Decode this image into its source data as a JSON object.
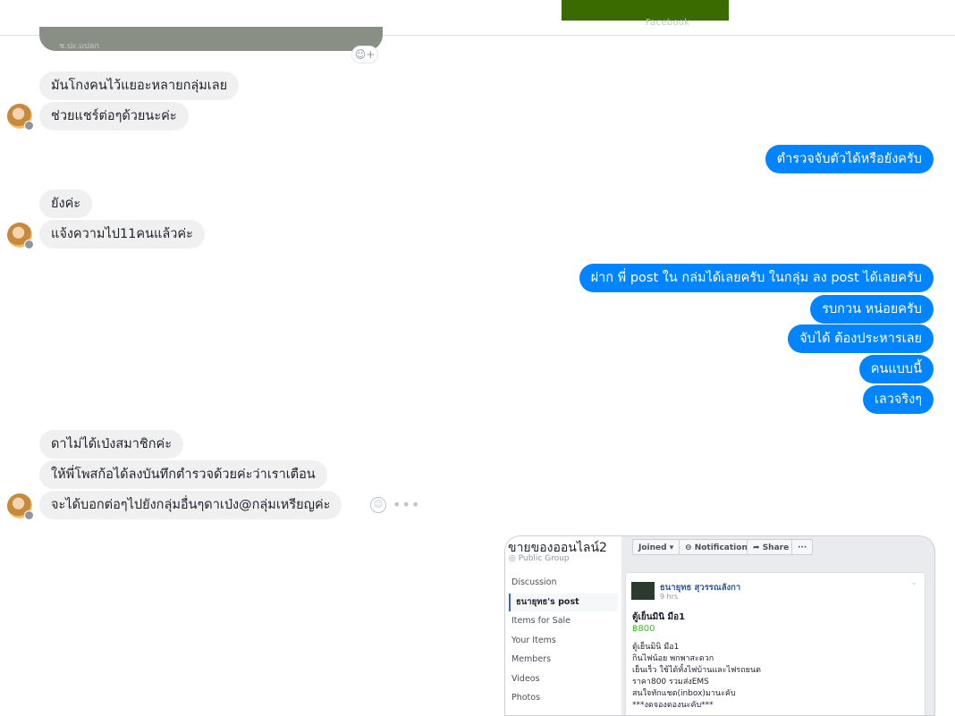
{
  "top": {
    "caption": "Facebook"
  },
  "prev_photo": {
    "text": "ช.ปะ.แปลก"
  },
  "received_group_1": [
    "มันโกงคนไว้แยอะหลายกลุ่มเลย",
    "ช่วยแชร์ต่อๆด้วยนะค่ะ"
  ],
  "sent_group_1": [
    "ตำรวจจับตัวได้หรือยังครับ"
  ],
  "received_group_2": [
    "ยังค่ะ",
    "แจ้งความไป11คนแล้วค่ะ"
  ],
  "sent_group_2": [
    "ฝาก พี่ post ใน กล่มได้เลยครับ ในกลุ่ม ลง post ได้เลยครับ",
    "รบกวน หน่อยครับ",
    "จับได้ ต้องประหารเลย",
    "คนแบบนี้",
    "เลวจริงๆ"
  ],
  "received_group_3": [
    "ดาไม่ได้เป่งสมาชิกค่ะ",
    "ให้พี่โพสก้อได้ลงบันทึกตำรวจด้วยค่ะว่าเราเตือน",
    "จะได้บอกต่อๆไปยังกลุ่มอื่นๆดาเป่ง@กลุ่มเหรียญค่ะ"
  ],
  "icons": {
    "react": "emoji-plus-icon",
    "smile": "smile-icon",
    "more": "more-icon"
  },
  "screenshot": {
    "group_name": "ขายของออนไลน์2",
    "group_type": "Public Group",
    "nav": [
      "Discussion",
      "ธนายุทธ's post",
      "Items for Sale",
      "Your Items",
      "Members",
      "Videos",
      "Photos"
    ],
    "buttons": [
      "Joined ▾",
      "Notifications",
      "Share",
      "···"
    ],
    "post": {
      "author": "ธนายุทธ สุวรรณลังกา",
      "time": "9 hrs",
      "title": "ตู้เย็นมินิ มือ1",
      "price": "฿800",
      "lines": [
        "ตู้เย็นมินิ มือ1",
        "กินไฟน้อย พกพาสะดวก",
        "เย็นเร็ว ใช้ได้ทั้งไฟบ้านและไฟรถยนต",
        "ราคา800 รวมส่งEMS",
        "สนใจทักแชต(inbox)มานะคับ",
        "***งดจองดองนะคับ***"
      ]
    }
  },
  "colors": {
    "outgoing": "#0084ff",
    "incoming": "#f1f0f0"
  }
}
